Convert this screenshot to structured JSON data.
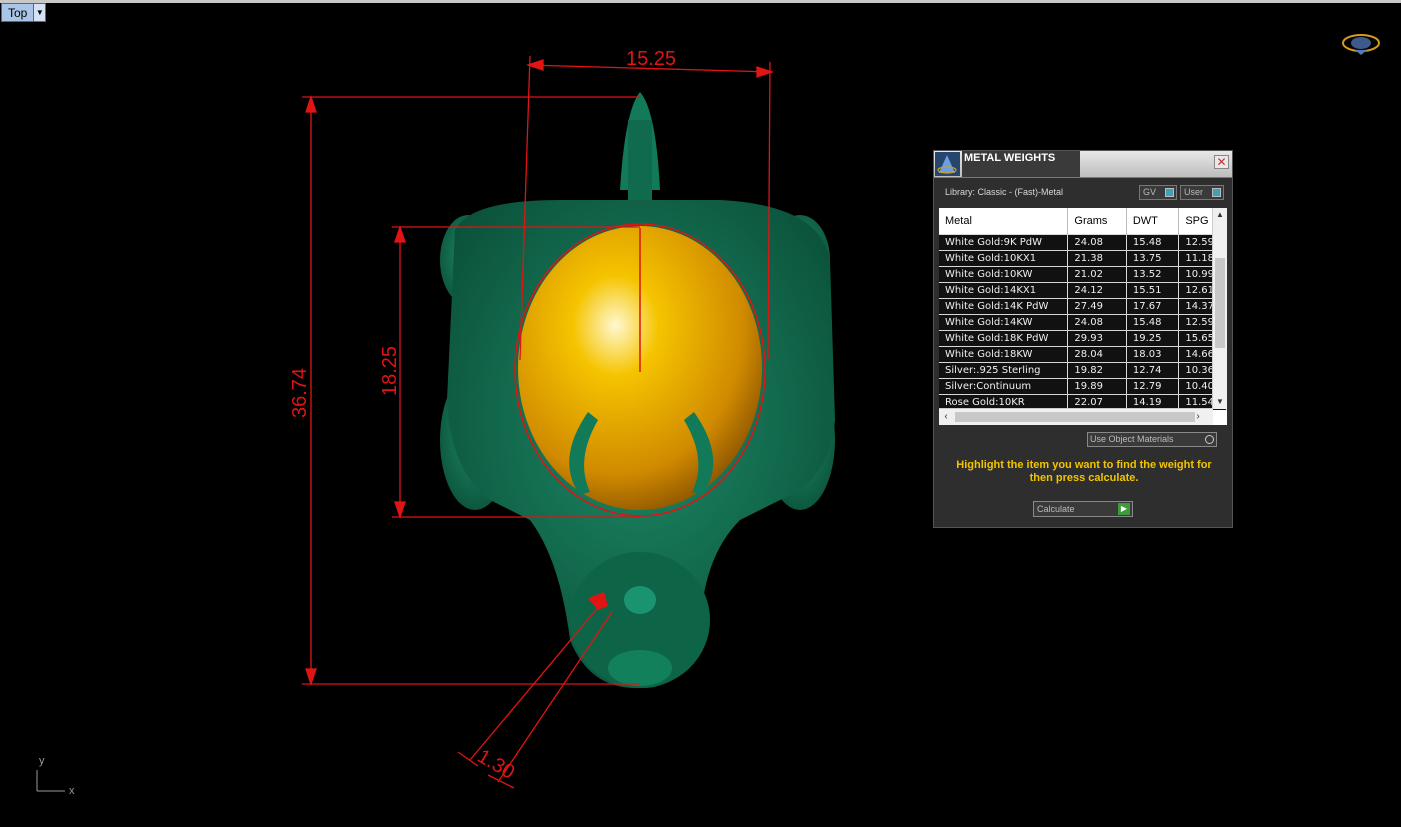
{
  "viewport": {
    "view_name": "Top",
    "view_dropdown_icon": "chevron-down-icon",
    "axis_y": "y",
    "axis_x": "x",
    "dimensions": {
      "width": "15.25",
      "height": "36.74",
      "inner_height": "18.25",
      "thickness": "1.30"
    },
    "colors": {
      "background": "#000000",
      "model_green": "#0f6a4e",
      "gem_gold": "#e0a400",
      "dimension_red": "#e01414"
    }
  },
  "panel": {
    "title": "METAL WEIGHTS",
    "close_icon": "close-icon",
    "library_label": "Library: Classic - (Fast)-Metal",
    "toggle_gv": "GV",
    "toggle_user": "User",
    "columns": [
      "Metal",
      "Grams",
      "DWT",
      "SPG"
    ],
    "rows": [
      [
        "White Gold:9K PdW",
        "24.08",
        "15.48",
        "12.59"
      ],
      [
        "White Gold:10KX1",
        "21.38",
        "13.75",
        "11.18"
      ],
      [
        "White Gold:10KW",
        "21.02",
        "13.52",
        "10.99"
      ],
      [
        "White Gold:14KX1",
        "24.12",
        "15.51",
        "12.61"
      ],
      [
        "White Gold:14K PdW",
        "27.49",
        "17.67",
        "14.37"
      ],
      [
        "White Gold:14KW",
        "24.08",
        "15.48",
        "12.59"
      ],
      [
        "White Gold:18K PdW",
        "29.93",
        "19.25",
        "15.65"
      ],
      [
        "White Gold:18KW",
        "28.04",
        "18.03",
        "14.66"
      ],
      [
        "Silver:.925 Sterling",
        "19.82",
        "12.74",
        "10.36"
      ],
      [
        "Silver:Continuum",
        "19.89",
        "12.79",
        "10.40"
      ],
      [
        "Rose Gold:10KR",
        "22.07",
        "14.19",
        "11.54"
      ]
    ],
    "use_object_materials": "Use Object Materials",
    "hint": "Highlight the item you want to find the weight for then press calculate.",
    "calculate": "Calculate",
    "colors": {
      "hint": "#f2c400",
      "panel_bg": "#2e2e2e"
    }
  }
}
